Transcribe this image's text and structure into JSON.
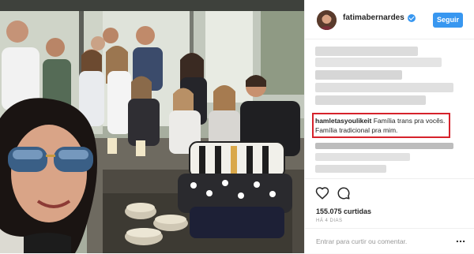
{
  "post": {
    "username": "fatimabernardes",
    "follow_label": "Seguir",
    "caption": {
      "author": "hamletasyoulikeit",
      "text": "Família trans pra vocês. Família tradicional pra mim."
    },
    "likes": "155.075 curtidas",
    "time": "HÁ 4 DIAS",
    "comment_placeholder": "Entrar para curtir ou comentar."
  },
  "icons": {
    "verified": "verified-badge-icon",
    "like": "heart-icon",
    "comment": "comment-bubble-icon",
    "more": "more-options-icon"
  },
  "colors": {
    "accent": "#3897f0",
    "highlight": "#d6222b",
    "text": "#262626",
    "muted": "#999999"
  }
}
